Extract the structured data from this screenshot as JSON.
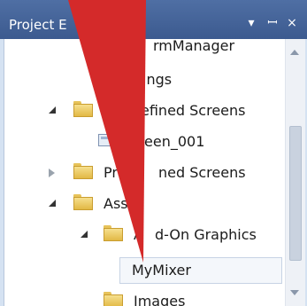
{
  "window": {
    "title": "Project E",
    "controls": {
      "dropdown_glyph": "▾",
      "pin_glyph": "ꟷ",
      "close_glyph": "×"
    }
  },
  "tree": {
    "items": [
      {
        "label": "rmManager",
        "icon": "none"
      },
      {
        "label": "ings",
        "icon": "none"
      },
      {
        "label": "efined Screens",
        "icon": "folder-icon",
        "expander": "open"
      },
      {
        "label": "een_001",
        "icon": "screen-icon"
      },
      {
        "label": "Pre",
        "label2": "ned Screens",
        "icon": "folder-icon",
        "expander": "closed"
      },
      {
        "label": "Asse",
        "icon": "folder-icon",
        "expander": "open"
      },
      {
        "label": "A",
        "label2": "d-On Graphics",
        "icon": "folder-icon",
        "expander": "open"
      },
      {
        "label": "MyMixer",
        "icon": "none",
        "selected": true
      },
      {
        "label": "Images",
        "icon": "folder-icon"
      }
    ]
  },
  "colors": {
    "titlebar": "#3c5a8f",
    "pointer": "#d42a2a",
    "folder": "#e2b845"
  }
}
